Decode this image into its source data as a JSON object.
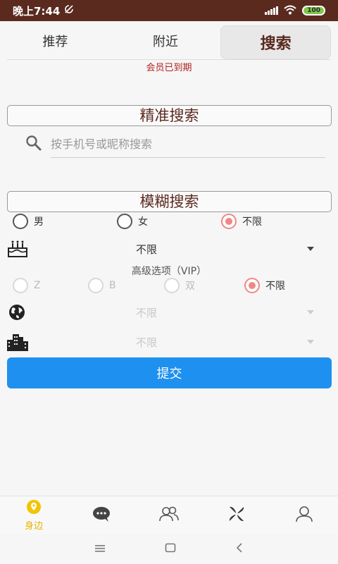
{
  "status_bar": {
    "time": "晚上7:44",
    "dnd_icon": "no-disturb-icon",
    "battery": "100"
  },
  "tabs": [
    {
      "label": "推荐",
      "active": false
    },
    {
      "label": "附近",
      "active": false
    },
    {
      "label": "搜索",
      "active": true
    }
  ],
  "membership_notice": "会员已到期",
  "exact_search": {
    "title": "精准搜索",
    "placeholder": "按手机号或昵称搜索",
    "icon": "search-icon"
  },
  "fuzzy_search": {
    "title": "模糊搜索",
    "gender_options": [
      {
        "label": "男",
        "checked": false
      },
      {
        "label": "女",
        "checked": false
      },
      {
        "label": "不限",
        "checked": true
      }
    ],
    "age": {
      "icon": "birthday-cake-icon",
      "value": "不限"
    },
    "advanced_label": "高级选项（VIP）",
    "role_options": [
      {
        "label": "Z",
        "checked": false,
        "disabled": true
      },
      {
        "label": "B",
        "checked": false,
        "disabled": true
      },
      {
        "label": "双",
        "checked": false,
        "disabled": true
      },
      {
        "label": "不限",
        "checked": true,
        "disabled": false
      }
    ],
    "region": {
      "icon": "globe-icon",
      "value": "不限"
    },
    "city": {
      "icon": "city-buildings-icon",
      "value": "不限"
    },
    "submit_label": "提交"
  },
  "bottom_nav": [
    {
      "label": "身边",
      "icon": "location-pin-icon",
      "active": true
    },
    {
      "icon": "chat-bubble-icon"
    },
    {
      "icon": "people-icon"
    },
    {
      "icon": "pinwheel-icon"
    },
    {
      "icon": "user-icon"
    }
  ],
  "colors": {
    "status_bar": "#5a2a1f",
    "accent_brown": "#5a2a1f",
    "submit_blue": "#1e90ef",
    "radio_checked": "#ee8888",
    "nav_active": "#e6b400",
    "notice_red": "#b22222"
  }
}
